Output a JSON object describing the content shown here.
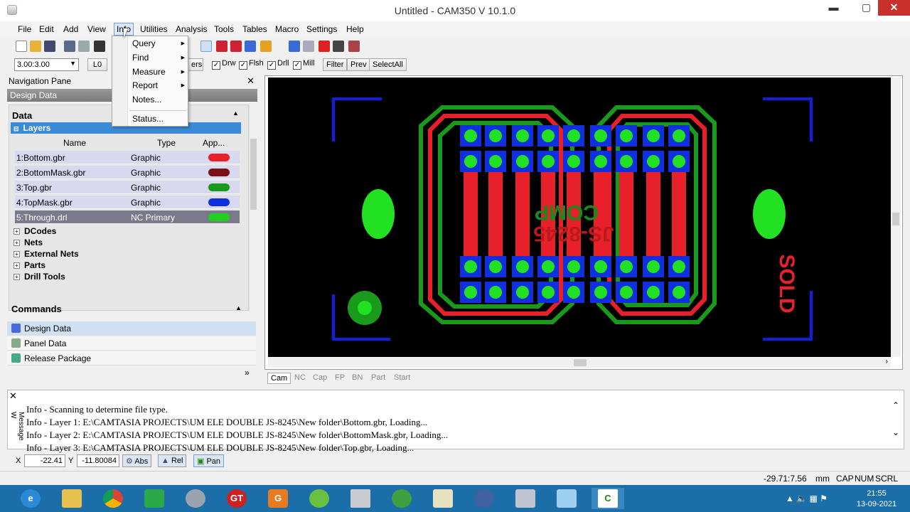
{
  "window": {
    "title": "Untitled - CAM350 V 10.1.0",
    "min": "▬",
    "max": "▢",
    "close": "✕"
  },
  "menu": [
    "File",
    "Edit",
    "Add",
    "View",
    "Info",
    "Utilities",
    "Analysis",
    "Tools",
    "Tables",
    "Macro",
    "Settings",
    "Help"
  ],
  "info_menu": [
    "Query",
    "Find",
    "Measure",
    "Report",
    "Notes...",
    "Status..."
  ],
  "toolbar2": {
    "scale": "3.00:3.00",
    "layer": "L0",
    "layers_btn": "ers",
    "checks": [
      "Drw",
      "Flsh",
      "Drll",
      "Mill"
    ],
    "buttons": [
      "Filter",
      "Prev",
      "SelectAll"
    ]
  },
  "nav": {
    "header": "Navigation Pane",
    "design_bar": "Design Data",
    "data_title": "Data",
    "layers_label": "Layers",
    "columns": [
      "Name",
      "Type",
      "App..."
    ],
    "layers": [
      {
        "name": "1:Bottom.gbr",
        "type": "Graphic",
        "color": "#e8202a"
      },
      {
        "name": "2:BottomMask.gbr",
        "type": "Graphic",
        "color": "#7a1018"
      },
      {
        "name": "3:Top.gbr",
        "type": "Graphic",
        "color": "#1a9a1a"
      },
      {
        "name": "4:TopMask.gbr",
        "type": "Graphic",
        "color": "#1030e0"
      },
      {
        "name": "5:Through.drl",
        "type": "NC Primary",
        "color": "#22d022"
      }
    ],
    "tree": [
      "DCodes",
      "Nets",
      "External Nets",
      "Parts",
      "Drill Tools"
    ],
    "commands_title": "Commands",
    "commands": [
      "Design Data",
      "Panel Data",
      "Release Package"
    ]
  },
  "tabs": [
    "Cam",
    "NC",
    "Cap",
    "FP",
    "BN",
    "Part",
    "Start"
  ],
  "messages": {
    "label": "Message W",
    "lines": [
      "Info - Scanning to determine file type.",
      "Info - Layer 1: E:\\CAMTASIA PROJECTS\\UM ELE DOUBLE JS-8245\\New folder\\Bottom.gbr, Loading...",
      "Info - Layer 2: E:\\CAMTASIA PROJECTS\\UM ELE DOUBLE JS-8245\\New folder\\BottomMask.gbr, Loading...",
      "Info - Layer 3: E:\\CAMTASIA PROJECTS\\UM ELE DOUBLE JS-8245\\New folder\\Top.gbr, Loading..."
    ]
  },
  "coords": {
    "x_label": "X",
    "x": "-22.41",
    "y_label": "Y",
    "y": "-11.80084",
    "abs": "Abs",
    "rel": "Rel",
    "pan": "Pan"
  },
  "status": {
    "pos": "-29.71:7.56",
    "unit": "mm",
    "caps": "CAP",
    "num": "NUM",
    "scrl": "SCRL"
  },
  "board": {
    "silk_comp": "COMP",
    "silk_part": "JS-8245",
    "silk_sold": "SOLD"
  },
  "taskbar": {
    "time": "21:55",
    "date": "13-09-2021"
  }
}
